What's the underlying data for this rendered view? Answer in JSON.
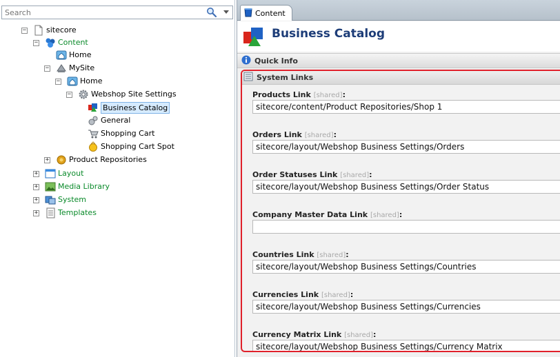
{
  "search": {
    "placeholder": "Search"
  },
  "tree": {
    "root": "sitecore",
    "content": "Content",
    "content_home": "Home",
    "mysite": "MySite",
    "mysite_home": "Home",
    "webshop_settings": "Webshop Site Settings",
    "business_catalog": "Business Catalog",
    "general": "General",
    "shopping_cart": "Shopping Cart",
    "shopping_cart_spot": "Shopping Cart Spot",
    "product_repositories": "Product Repositories",
    "layout": "Layout",
    "media_library": "Media Library",
    "system": "System",
    "templates": "Templates",
    "expand_symbol": "+",
    "collapse_symbol": "−"
  },
  "editor": {
    "tab_label": "Content",
    "title": "Business Catalog",
    "quick_info": "Quick Info",
    "section_title": "System Links",
    "shared_tag": "[shared]",
    "fields": [
      {
        "label": "Products Link",
        "value": "sitecore/content/Product Repositories/Shop 1"
      },
      {
        "label": "Orders Link",
        "value": "sitecore/layout/Webshop Business Settings/Orders"
      },
      {
        "label": "Order Statuses Link",
        "value": "sitecore/layout/Webshop Business Settings/Order Status"
      },
      {
        "label": "Company Master Data Link",
        "value": ""
      },
      {
        "label": "Countries Link",
        "value": "sitecore/layout/Webshop Business Settings/Countries"
      },
      {
        "label": "Currencies Link",
        "value": "sitecore/layout/Webshop Business Settings/Currencies"
      },
      {
        "label": "Currency Matrix Link",
        "value": "sitecore/layout/Webshop Business Settings/Currency Matrix"
      }
    ]
  },
  "colors": {
    "highlight_border": "#e0202a",
    "green_text": "#0a8a2a",
    "title_text": "#1d3d78"
  }
}
